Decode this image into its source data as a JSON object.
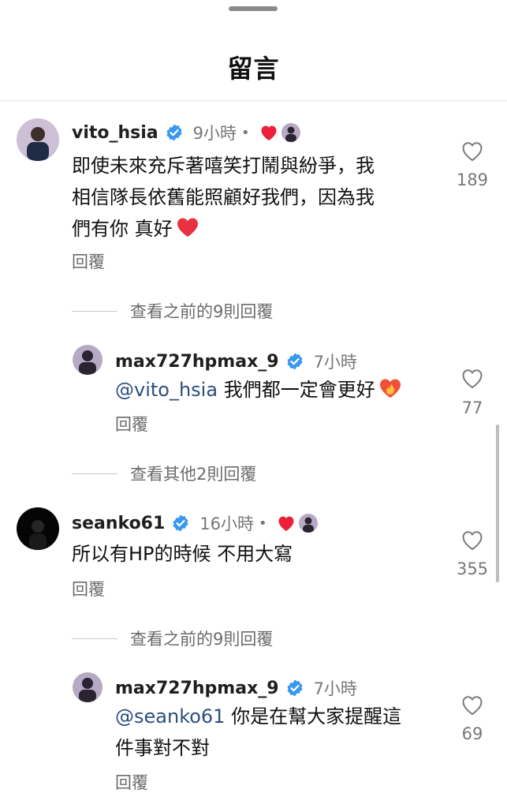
{
  "header": {
    "title": "留言"
  },
  "comments": [
    {
      "username": "vito_hsia",
      "time": "9小時",
      "dot": "•",
      "text": "即使未來充斥著嘻笑打鬧與紛爭，我相信隊長依舊能照顧好我們，因為我們有你 真好",
      "text_lines": [
        "即使未來充斥著嘻笑打鬧與紛爭，我",
        "相信隊長依舊能照顧好我們，因為我",
        "們有你 真好"
      ],
      "likes": "189",
      "reply_label": "回覆",
      "view_more": "查看之前的9則回覆",
      "reply": {
        "username": "max727hpmax_9",
        "time": "7小時",
        "mention": "@vito_hsia",
        "text": " 我們都一定會更好",
        "likes": "77",
        "reply_label": "回覆"
      },
      "view_more_after": "查看其他2則回覆"
    },
    {
      "username": "seanko61",
      "time": "16小時",
      "dot": "•",
      "text": "所以有HP的時候 不用大寫",
      "likes": "355",
      "reply_label": "回覆",
      "view_more": "查看之前的9則回覆",
      "reply": {
        "username": "max727hpmax_9",
        "time": "7小時",
        "mention": "@seanko61",
        "text_line1": " 你是在幫大家提醒這",
        "text_line2": "件事對不對",
        "likes": "69",
        "reply_label": "回覆"
      }
    }
  ],
  "icons": {
    "verified": "verified-badge-icon",
    "like": "heart-outline-icon",
    "liked_by_author": "red-heart-icon"
  },
  "colors": {
    "verified_blue": "#3897f0",
    "heart_red": "#ed1f3a",
    "mention_blue": "#2b4f7e"
  }
}
